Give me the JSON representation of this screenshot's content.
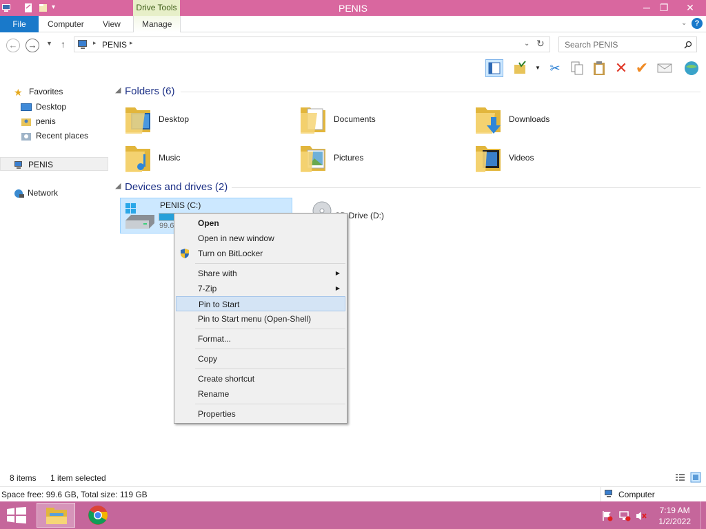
{
  "window": {
    "title": "PENIS",
    "contextual_tab_group": "Drive Tools",
    "controls": {
      "minimize": "─",
      "maximize": "❐",
      "close": "✕"
    }
  },
  "ribbon": {
    "tabs": [
      "File",
      "Computer",
      "View",
      "Manage"
    ],
    "help": "?"
  },
  "address": {
    "path": "PENIS",
    "search_placeholder": "Search PENIS"
  },
  "sidebar": {
    "favorites": "Favorites",
    "fav_items": [
      "Desktop",
      "penis",
      "Recent places"
    ],
    "computer": "PENIS",
    "network": "Network"
  },
  "content": {
    "folders_header": "Folders (6)",
    "folders": [
      "Desktop",
      "Documents",
      "Downloads",
      "Music",
      "Pictures",
      "Videos"
    ],
    "devices_header": "Devices and drives (2)",
    "drive_c": {
      "label": "PENIS (C:)",
      "free_text": "99.6",
      "used_fraction": 0.16
    },
    "drive_d": {
      "label": "CD Drive (D:)"
    }
  },
  "context_menu": {
    "items": [
      "Open",
      "Open in new window",
      "Turn on BitLocker",
      "Share with",
      "7-Zip",
      "Pin to Start",
      "Pin to Start menu (Open-Shell)",
      "Format...",
      "Copy",
      "Create shortcut",
      "Rename",
      "Properties"
    ],
    "highlighted": "Pin to Start"
  },
  "status": {
    "items_count": "8 items",
    "selected": "1 item selected",
    "details": "Space free: 99.6 GB, Total size: 119 GB",
    "location": "Computer"
  },
  "taskbar": {
    "time": "7:19 AM",
    "date": "1/2/2022"
  },
  "colors": {
    "titlebar": "#d9679f",
    "taskbar": "#c5669b",
    "file_tab": "#1979ca",
    "selection": "#cce8ff"
  }
}
